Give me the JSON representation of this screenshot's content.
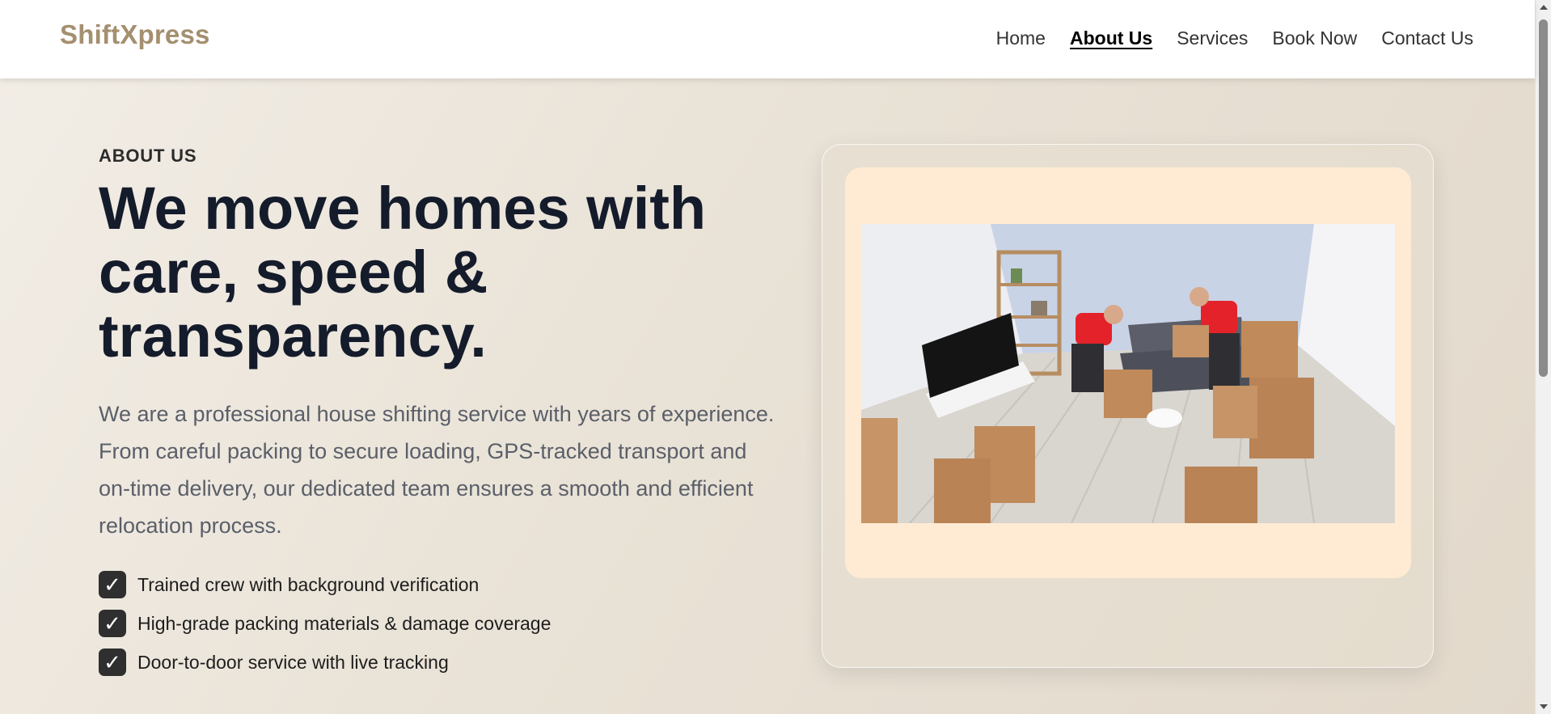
{
  "nav": {
    "brand": "ShiftXpress",
    "links": [
      {
        "label": "Home",
        "active": false
      },
      {
        "label": "About Us",
        "active": true
      },
      {
        "label": "Services",
        "active": false
      },
      {
        "label": "Book Now",
        "active": false
      },
      {
        "label": "Contact Us",
        "active": false
      }
    ]
  },
  "about": {
    "eyebrow": "ABOUT US",
    "headline": "We move homes with care, speed & transparency.",
    "description": "We are a professional house shifting service with years of experience. From careful packing to secure loading, GPS-tracked transport and on-time delivery, our dedicated team ensures a smooth and efficient relocation process.",
    "features": [
      "Trained crew with background verification",
      "High-grade packing materials & damage coverage",
      "Door-to-door service with live tracking"
    ],
    "check_icon": "check-icon"
  },
  "image": {
    "subject": "movers-packing-boxes-photo"
  },
  "colors": {
    "brand": "#a48f6f",
    "heading": "#141b2b",
    "body_text": "#5a5f69",
    "image_frame": "#ffebd3",
    "check_bg": "#2f2f2f"
  }
}
